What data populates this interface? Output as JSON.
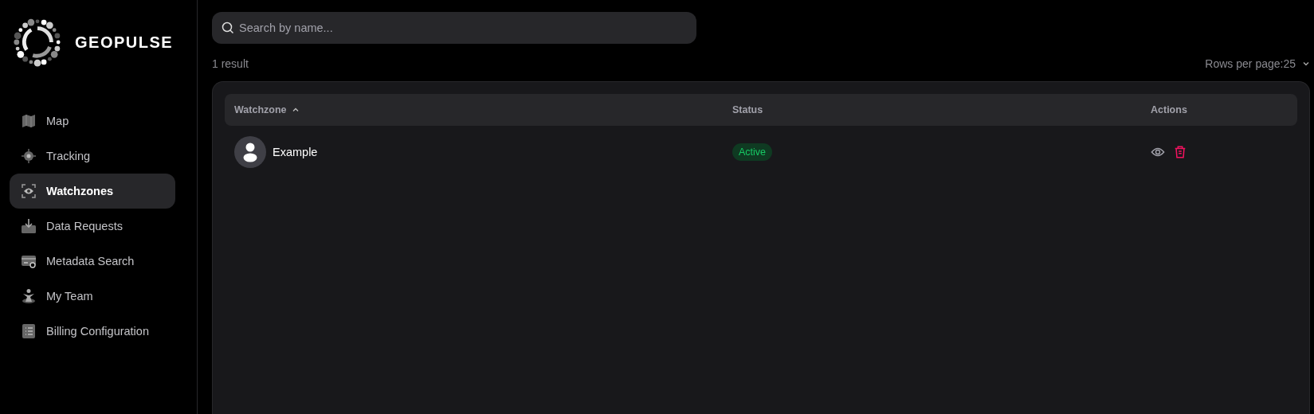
{
  "brand": {
    "name": "GEOPULSE"
  },
  "sidebar": {
    "items": [
      {
        "label": "Map",
        "selected": false
      },
      {
        "label": "Tracking",
        "selected": false
      },
      {
        "label": "Watchzones",
        "selected": true
      },
      {
        "label": "Data Requests",
        "selected": false
      },
      {
        "label": "Metadata Search",
        "selected": false
      },
      {
        "label": "My Team",
        "selected": false
      },
      {
        "label": "Billing Configuration",
        "selected": false
      }
    ]
  },
  "search": {
    "placeholder": "Search by name..."
  },
  "result_count": "1 result",
  "rows_per_page": {
    "label": "Rows per page:",
    "value": "25"
  },
  "table": {
    "columns": [
      {
        "label": "Watchzone",
        "sorted": true
      },
      {
        "label": "Status",
        "sorted": false
      },
      {
        "label": "Actions",
        "sorted": false
      }
    ],
    "rows": [
      {
        "name": "Example",
        "status": {
          "label": "Active",
          "kind": "active"
        }
      }
    ]
  }
}
